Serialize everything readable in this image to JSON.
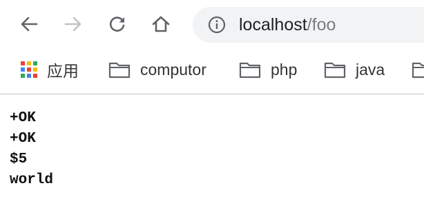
{
  "address_bar": {
    "host": "localhost",
    "path": "/foo"
  },
  "bookmarks_bar": {
    "items": [
      {
        "label": "应用",
        "icon": "apps-grid-icon"
      },
      {
        "label": "computor",
        "icon": "folder-icon"
      },
      {
        "label": "php",
        "icon": "folder-icon"
      },
      {
        "label": "java",
        "icon": "folder-icon"
      }
    ]
  },
  "page_body": {
    "lines": [
      "+OK",
      "+OK",
      "$5",
      "world"
    ]
  },
  "colors": {
    "apps_red": "#ea4335",
    "apps_yellow": "#fbbc05",
    "apps_green": "#34a853",
    "apps_blue": "#4285f4"
  }
}
